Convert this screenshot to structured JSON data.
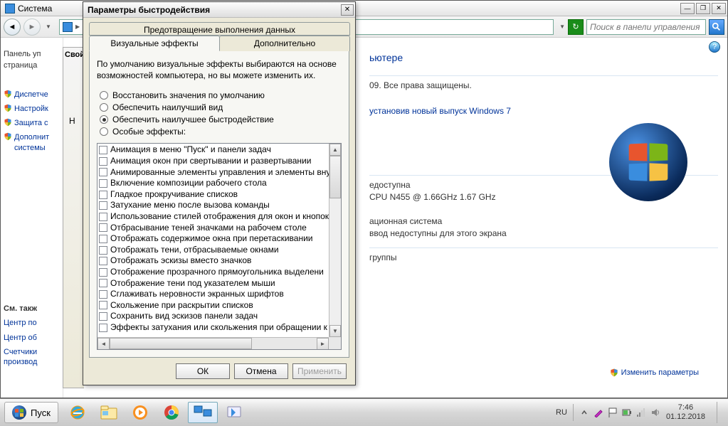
{
  "bgWindow": {
    "title": "Система",
    "searchPlaceholder": "Поиск в панели управления"
  },
  "sidebar": {
    "home1": "Панель уп",
    "home2": "страница",
    "items": [
      "Диспетче",
      "Настройк",
      "Защита с",
      "Дополнит системы"
    ],
    "seeAlso": "См. такж",
    "links": [
      "Центр по",
      "Центр об",
      "Счетчики производ"
    ]
  },
  "content": {
    "titleSuffix": "ьютере",
    "rights": "09. Все права защищены.",
    "upgradeLink": "установив новый выпуск Windows 7",
    "unavail": "едоступна",
    "cpu": "CPU N455   @ 1.66GHz   1.67 GHz",
    "osType": "ационная система",
    "pen": "ввод недоступны для этого экрана",
    "group": "группы",
    "changeParams": "Изменить параметры"
  },
  "propsTab": "Свой",
  "dialog": {
    "title": "Параметры быстродействия",
    "tabTop": "Предотвращение выполнения данных",
    "tab1": "Визуальные эффекты",
    "tab2": "Дополнительно",
    "desc": "По умолчанию визуальные эффекты выбираются на основе возможностей компьютера, но вы можете изменить их.",
    "radios": [
      "Восстановить значения по умолчанию",
      "Обеспечить наилучший вид",
      "Обеспечить наилучшее быстродействие",
      "Особые эффекты:"
    ],
    "selectedRadio": 2,
    "options": [
      "Анимация в меню \"Пуск\" и панели задач",
      "Анимация окон при свертывании и развертывании",
      "Анимированные элементы управления и элементы вну",
      "Включение композиции рабочего стола",
      "Гладкое прокручивание списков",
      "Затухание меню после вызова команды",
      "Использование стилей отображения для окон и кнопок",
      "Отбрасывание теней значками на рабочем столе",
      "Отображать содержимое окна при перетаскивании",
      "Отображать тени, отбрасываемые окнами",
      "Отображать эскизы вместо значков",
      "Отображение прозрачного прямоугольника выделени",
      "Отображение тени под указателем мыши",
      "Сглаживать неровности экранных шрифтов",
      "Скольжение при раскрытии списков",
      "Сохранить вид эскизов панели задач",
      "Эффекты затухания или скольжения при обращении к"
    ],
    "buttons": {
      "ok": "ОК",
      "cancel": "Отмена",
      "apply": "Применить"
    }
  },
  "taskbar": {
    "start": "Пуск",
    "lang": "RU",
    "time": "7:46",
    "date": "01.12.2018"
  }
}
